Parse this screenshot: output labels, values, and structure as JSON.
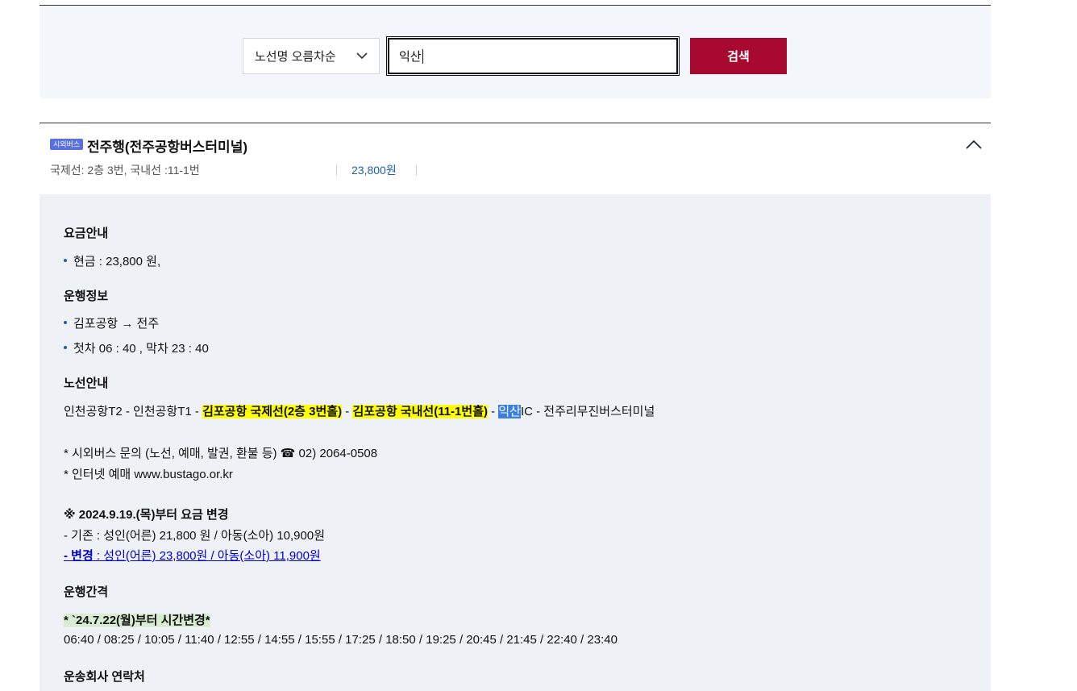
{
  "search": {
    "sort_label": "노선명 오름차순",
    "query": "익산",
    "button_label": "검색"
  },
  "route": {
    "badge": "시외버스",
    "title": "전주행(전주공항버스터미널)",
    "platform": "국제선: 2층 3번, 국내선 :11-1번",
    "price": "23,800원"
  },
  "detail": {
    "fare_heading": "요금안내",
    "fare_cash": "현금 : 23,800 원,",
    "ops_heading": "운행정보",
    "ops_route": "김포공항 → 전주",
    "ops_times": "첫차 06 : 40 , 막차 23 : 40",
    "route_heading": "노선안내",
    "stops": {
      "s1": "인천공항T2 - 인천공항T1 - ",
      "s2": "김포공항 국제선(2층 3번홀)",
      "s3": " - ",
      "s4": "김포공항 국내선(11-1번홀)",
      "s5": " - ",
      "s6": "익산",
      "s7": "IC - 전주리무진버스터미널"
    },
    "inquiry": "* 시외버스 문의 (노선, 예매, 발권, 환불 등) ☎ 02) 2064-0508",
    "internet": "* 인터넷 예매 www.bustago.or.kr",
    "fare_change_heading": "※ 2024.9.19.(목)부터 요금 변경",
    "fare_old": "- 기존 : 성인(어른) 21,800 원 / 아동(소아) 10,900원",
    "fare_new_prefix": "- 변경",
    "fare_new_rest": " : 성인(어른) 23,800원 / 아동(소아) 11,900원",
    "interval_heading": "운행간격",
    "interval_note": "* `24.7.22(월)부터 시간변경*",
    "interval_times": "06:40 / 08:25 / 10:05 / 11:40 / 12:55 / 14:55 / 15:55 / 17:25 / 18:50 / 19:25 / 20:45 / 21:45 / 22:40 / 23:40",
    "contact_heading": "운송회사 연락처"
  },
  "colors": {
    "accent": "#a8092f",
    "link": "#1f5fa8",
    "highlight": "#ffff00",
    "panel": "#eef1f6"
  }
}
